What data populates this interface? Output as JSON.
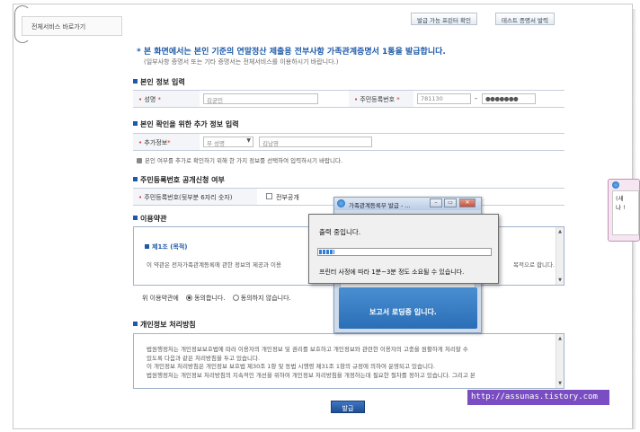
{
  "sidebar": {
    "link_label": "전체서비스 바로가기"
  },
  "top_buttons": {
    "printer_check": "발급 가능 프린터 확인",
    "test_print": "테스트 증명서 발력"
  },
  "headline": "* 본 화면에서는 본인 기준의 연말정산 제출용 전부사항 가족관계증명서 1통을 발급합니다.",
  "subline": "(일부사항 증명서 또는 기타 증명서는 전체서비스를 이용하시기 바랍니다.)",
  "personal": {
    "section_title": "본인 정보 입력",
    "name_label": "성명",
    "name_value": "김균민",
    "rrn_label": "주민등록번호",
    "rrn_front": "781130",
    "rrn_back": "●●●●●●●"
  },
  "extra": {
    "section_title": "본인 확인을 위한 추가 정보 입력",
    "label": "추가정보",
    "select_value": "부 성명",
    "input_value": "김남영",
    "note": "본인 여부를 추가로 확인하기 위해 한 가지 정보를 선택하여 입력하시기 바랍니다."
  },
  "disclosure": {
    "section_title": "주민등록번호 공개신청 여부",
    "label": "주민등록번호(뒷부분 6자리 숫자)",
    "checkbox_label": "전부공개"
  },
  "terms": {
    "section_title": "이용약관",
    "article_title": "제1조 (목적)",
    "body_left": "이 약관은 전자가족관계등록에 관한 정보의 제공과 이용",
    "body_right": "목적으로 합니다.",
    "consent_label": "위 이용약관에",
    "agree": "동의합니다.",
    "disagree": "동의하지 않습니다."
  },
  "privacy": {
    "section_title": "개인정보 처리방침",
    "lines": [
      "법원행정처는 개인정보보호법에 따라 이용자의 개인정보 및 권리를 보호하고 개인정보와 관련한 이용자의 고충을 원활하게 처리할 수",
      "있도록 다음과 같은 처리방침을 두고 있습니다.",
      "이 개인정보 처리방침은 개인정보 보호법 제30조 1항 및 동법 시행령 제31조 1항의 규정에 의하여 운영되고 있습니다.",
      "법원행정처는 개인정보 처리방침의 지속적인 개선을 위하여 개인정보 처리방침을 개정하는데 필요한 절차를 정하고 있습니다. 그리고 본"
    ]
  },
  "issue_button": "발급",
  "popup": {
    "title": "가족관계등록부 발급 - ...",
    "loading_text": "보고서 로딩중 입니다."
  },
  "dialog": {
    "status": "출력 중입니다.",
    "progress": 0.09,
    "info": "프린터 사정에 따라 1분~3분 정도 소요될 수 있습니다."
  },
  "side_window": {
    "line1": "(새",
    "line2": "나 !"
  },
  "watermark": "http://assunas.tistory.com",
  "colors": {
    "accent": "#1e5aa8",
    "progress": "#2e7fd8",
    "watermark": "#7a4ec2"
  }
}
